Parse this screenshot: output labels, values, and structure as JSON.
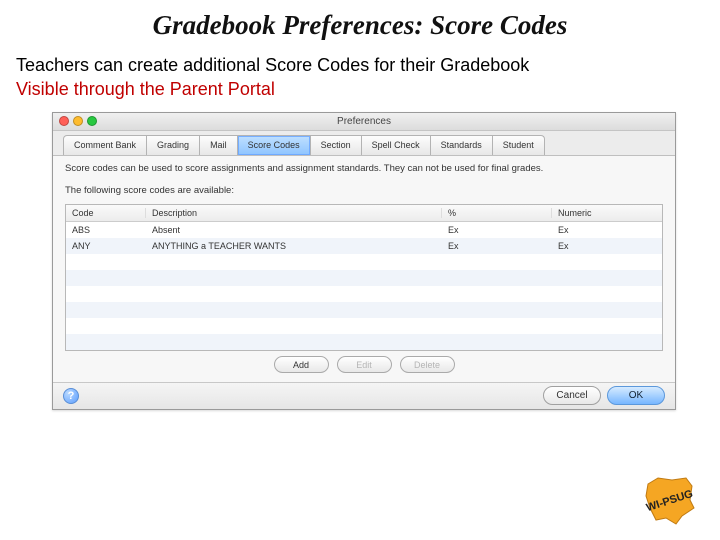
{
  "slide": {
    "title": "Gradebook Preferences:  Score Codes",
    "line1": "Teachers can create additional Score Codes for their Gradebook",
    "line2": "Visible through the Parent Portal"
  },
  "window": {
    "title": "Preferences",
    "traffic": {
      "close": "#ff5f57",
      "min": "#febc2e",
      "zoom": "#28c840"
    },
    "tabs": [
      {
        "label": "Comment Bank"
      },
      {
        "label": "Grading"
      },
      {
        "label": "Mail"
      },
      {
        "label": "Score Codes",
        "selected": true
      },
      {
        "label": "Section"
      },
      {
        "label": "Spell Check"
      },
      {
        "label": "Standards"
      },
      {
        "label": "Student"
      }
    ],
    "desc1": "Score codes can be used to score assignments and assignment standards. They can not be used for final grades.",
    "desc2": "The following score codes are available:",
    "headers": {
      "code": "Code",
      "desc": "Description",
      "pct": "%",
      "num": "Numeric"
    },
    "rows": [
      {
        "code": "ABS",
        "desc": "Absent",
        "pct": "Ex",
        "num": "Ex"
      },
      {
        "code": "ANY",
        "desc": "ANYTHING a TEACHER WANTS",
        "pct": "Ex",
        "num": "Ex"
      }
    ],
    "empty_rows": 6,
    "row_actions": {
      "add": "Add",
      "edit": "Edit",
      "del": "Delete"
    },
    "footer": {
      "help": "?",
      "cancel": "Cancel",
      "ok": "OK"
    }
  },
  "logo": {
    "text": "WI-PSUG"
  }
}
